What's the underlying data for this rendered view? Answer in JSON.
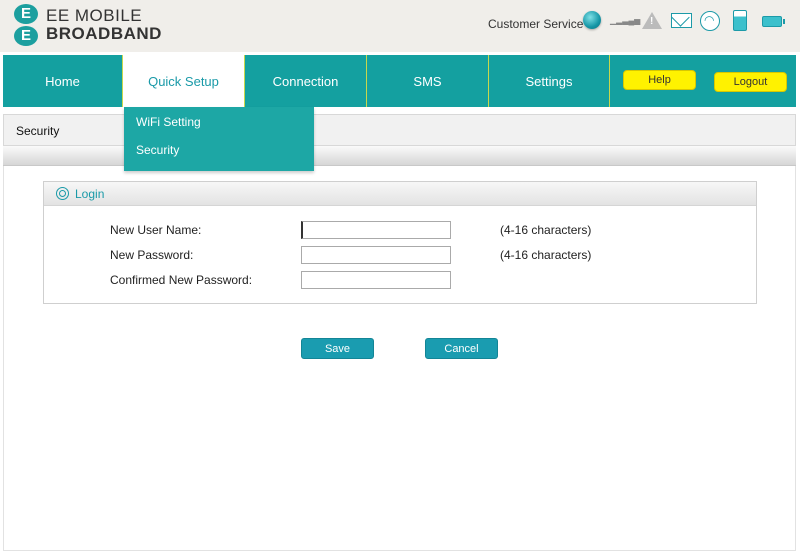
{
  "brand": {
    "mark": [
      "E",
      "E"
    ],
    "line1": "EE MOBILE",
    "line2": "BROADBAND",
    "accent": "#1c9f9f"
  },
  "header": {
    "customer_service": "Customer Service"
  },
  "status_icons": [
    "globe-status-icon",
    "signal-strength-icon",
    "warning-icon",
    "mail-icon",
    "wifi-icon",
    "sim-icon",
    "battery-icon"
  ],
  "nav": {
    "tabs": [
      {
        "label": "Home",
        "active": false
      },
      {
        "label": "Quick Setup",
        "active": true
      },
      {
        "label": "Connection",
        "active": false
      },
      {
        "label": "SMS",
        "active": false
      },
      {
        "label": "Settings",
        "active": false
      }
    ],
    "help": "Help",
    "logout": "Logout",
    "color": "#14a0a0",
    "button_color": "#fff200"
  },
  "dropdown": {
    "items": [
      "WiFi Setting",
      "Security"
    ]
  },
  "page": {
    "section_title": "Security"
  },
  "login_panel": {
    "title": "Login",
    "fields": [
      {
        "label": "New User Name:",
        "value": "",
        "hint": "(4-16 characters)"
      },
      {
        "label": "New Password:",
        "value": "",
        "hint": "(4-16 characters)"
      },
      {
        "label": "Confirmed New Password:",
        "value": "",
        "hint": ""
      }
    ]
  },
  "actions": {
    "save": "Save",
    "cancel": "Cancel",
    "color": "#1a9cb0"
  }
}
